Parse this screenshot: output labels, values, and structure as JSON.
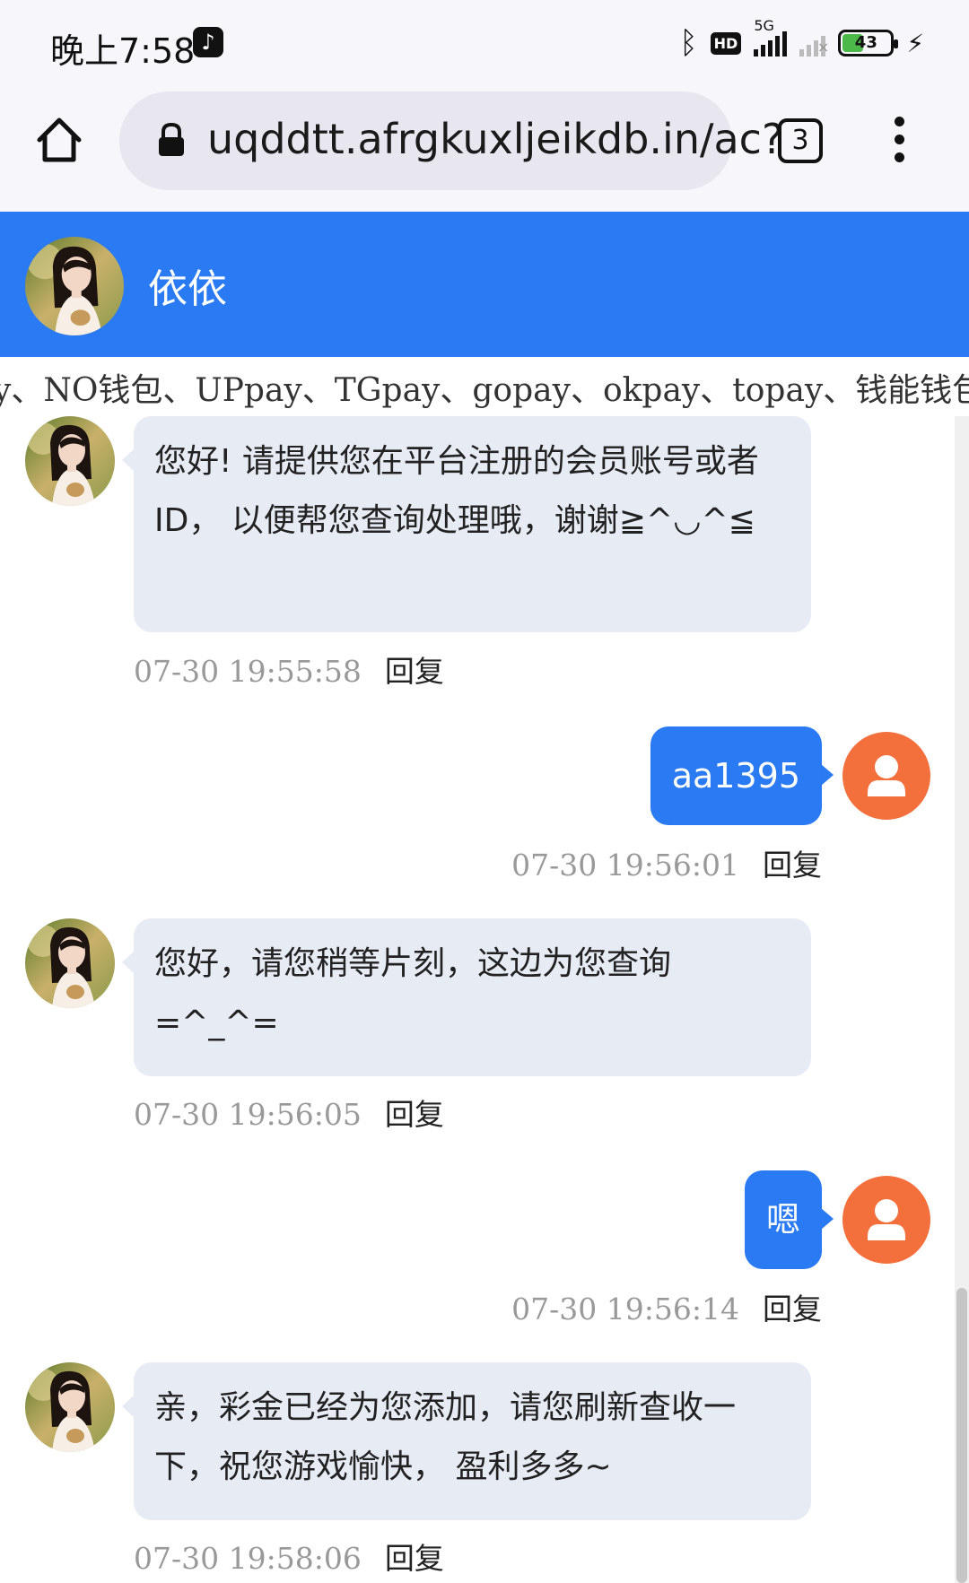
{
  "status_bar": {
    "time": "晚上7:58",
    "network": "5G",
    "hd": "HD",
    "battery": "43",
    "battery_level": 0.43
  },
  "browser": {
    "url": "uqddtt.afrgkuxljeikdb.in/ac?",
    "tab_count": "3"
  },
  "chat_header": {
    "agent_name": "依依"
  },
  "marquee": {
    "text": "y、NO钱包、UPpay、TGpay、gopay、okpay、topay、钱能钱包、"
  },
  "messages": [
    {
      "sender": "agent",
      "text": "您好! 请提供您在平台注册的会员账号或者 ID， 以便帮您查询处理哦，谢谢≧^◡^≦",
      "timestamp": "07-30 19:55:58",
      "reply": "回复"
    },
    {
      "sender": "user",
      "text": "aa1395",
      "timestamp": "07-30 19:56:01",
      "reply": "回复"
    },
    {
      "sender": "agent",
      "text": "您好，请您稍等片刻，这边为您查询=^_^=",
      "timestamp": "07-30 19:56:05",
      "reply": "回复"
    },
    {
      "sender": "user",
      "text": "嗯",
      "timestamp": "07-30 19:56:14",
      "reply": "回复"
    },
    {
      "sender": "agent",
      "text": "亲，彩金已经为您添加，请您刷新查收一下，祝您游戏愉快， 盈利多多~",
      "timestamp": "07-30 19:58:06",
      "reply": "回复"
    }
  ],
  "colors": {
    "header_blue": "#2a7af3",
    "agent_bubble": "#e7ebf4",
    "user_bubble": "#2a7af3",
    "user_avatar": "#f36f3c"
  }
}
